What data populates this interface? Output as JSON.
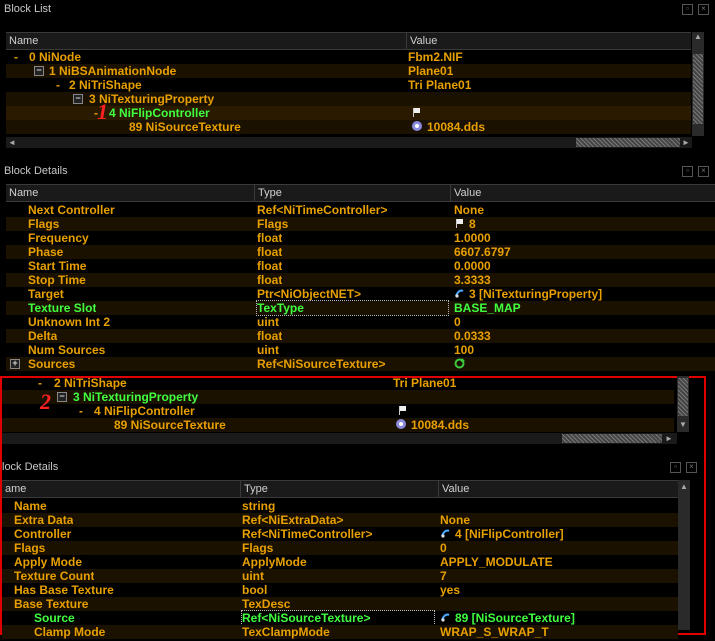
{
  "top_block_list": {
    "title": "Block List",
    "col_name": "Name",
    "col_value": "Value",
    "rows": [
      {
        "name": "0 NiNode",
        "value": "Fbm2.NIF"
      },
      {
        "name": "1 NiBSAnimationNode",
        "value": "Plane01"
      },
      {
        "name": "2 NiTriShape",
        "value": "Tri Plane01"
      },
      {
        "name": "3 NiTexturingProperty",
        "value": ""
      },
      {
        "name": "4 NiFlipController",
        "value": ""
      },
      {
        "name": "89 NiSourceTexture",
        "value": "10084.dds"
      }
    ]
  },
  "top_block_details": {
    "title": "Block Details",
    "col_name": "Name",
    "col_type": "Type",
    "col_value": "Value",
    "rows": [
      {
        "name": "Next Controller",
        "type": "Ref<NiTimeController>",
        "value": "None"
      },
      {
        "name": "Flags",
        "type": "Flags",
        "value": "8"
      },
      {
        "name": "Frequency",
        "type": "float",
        "value": "1.0000"
      },
      {
        "name": "Phase",
        "type": "float",
        "value": "6607.6797"
      },
      {
        "name": "Start Time",
        "type": "float",
        "value": "0.0000"
      },
      {
        "name": "Stop Time",
        "type": "float",
        "value": "3.3333"
      },
      {
        "name": "Target",
        "type": "Ptr<NiObjectNET>",
        "value": "3 [NiTexturingProperty]"
      },
      {
        "name": "Texture Slot",
        "type": "TexType",
        "value": "BASE_MAP"
      },
      {
        "name": "Unknown Int 2",
        "type": "uint",
        "value": "0"
      },
      {
        "name": "Delta",
        "type": "float",
        "value": "0.0333"
      },
      {
        "name": "Num Sources",
        "type": "uint",
        "value": "100"
      },
      {
        "name": "Sources",
        "type": "Ref<NiSourceTexture>",
        "value": ""
      }
    ]
  },
  "bottom_block_list": {
    "rows": [
      {
        "name": "2 NiTriShape",
        "value": "Tri Plane01"
      },
      {
        "name": "3 NiTexturingProperty",
        "value": ""
      },
      {
        "name": "4 NiFlipController",
        "value": ""
      },
      {
        "name": "89 NiSourceTexture",
        "value": "10084.dds"
      }
    ]
  },
  "bottom_block_details": {
    "title": "lock Details",
    "col_name": "ame",
    "col_type": "Type",
    "col_value": "Value",
    "rows": [
      {
        "name": "Name",
        "type": "string",
        "value": ""
      },
      {
        "name": "Extra Data",
        "type": "Ref<NiExtraData>",
        "value": "None"
      },
      {
        "name": "Controller",
        "type": "Ref<NiTimeController>",
        "value": "4 [NiFlipController]"
      },
      {
        "name": "Flags",
        "type": "Flags",
        "value": "0"
      },
      {
        "name": "Apply Mode",
        "type": "ApplyMode",
        "value": "APPLY_MODULATE"
      },
      {
        "name": "Texture Count",
        "type": "uint",
        "value": "7"
      },
      {
        "name": "Has Base Texture",
        "type": "bool",
        "value": "yes"
      },
      {
        "name": "Base Texture",
        "type": "TexDesc",
        "value": ""
      },
      {
        "name": "Source",
        "type": "Ref<NiSourceTexture>",
        "value": "89 [NiSourceTexture]"
      },
      {
        "name": "Clamp Mode",
        "type": "TexClampMode",
        "value": "WRAP_S_WRAP_T"
      }
    ]
  },
  "annotations": {
    "marker_1": "1",
    "marker_2": "2"
  },
  "colors": {
    "text": "#e8a000",
    "highlight": "#40ff40",
    "annotation": "#e00000"
  }
}
